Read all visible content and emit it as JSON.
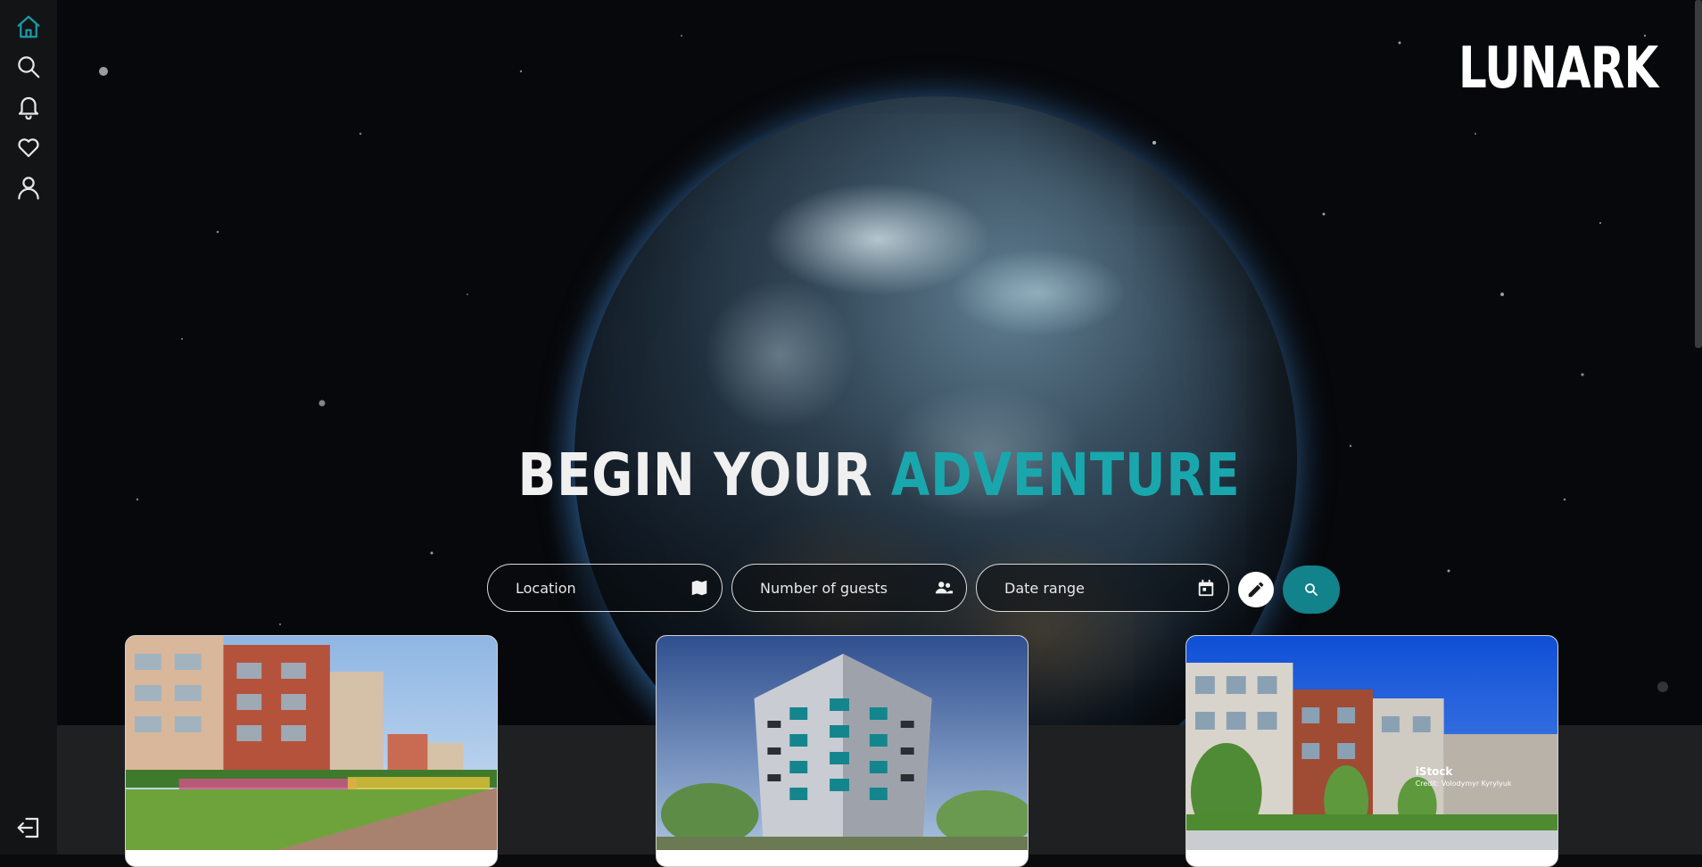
{
  "brand": {
    "logo": "LUNARK"
  },
  "hero": {
    "headline_part1": "BEGIN YOUR",
    "headline_part2": "ADVENTURE"
  },
  "search": {
    "location_placeholder": "Location",
    "guests_placeholder": "Number of guests",
    "dates_placeholder": "Date range"
  },
  "sidebar": {
    "items": [
      {
        "icon": "home-icon",
        "active": true
      },
      {
        "icon": "search-icon",
        "active": false
      },
      {
        "icon": "bell-icon",
        "active": false
      },
      {
        "icon": "heart-icon",
        "active": false
      },
      {
        "icon": "user-icon",
        "active": false
      }
    ],
    "logout_icon": "logout-icon"
  },
  "listings": [
    {
      "image_overlay": ""
    },
    {
      "image_overlay": ""
    },
    {
      "image_overlay_brand": "iStock",
      "image_overlay_credit": "Credit: Volodymyr Kyrylyuk"
    }
  ],
  "colors": {
    "accent": "#19a7ad",
    "search_button": "#12828b",
    "sidebar_bg": "#131416"
  }
}
